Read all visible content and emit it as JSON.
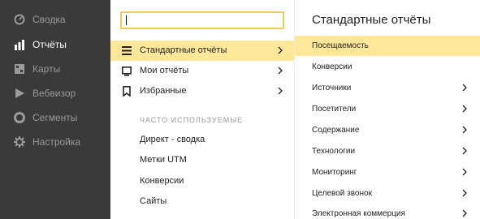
{
  "sidebar": {
    "items": [
      {
        "label": "Сводка",
        "icon": "dashboard-icon"
      },
      {
        "label": "Отчёты",
        "icon": "bar-chart-icon"
      },
      {
        "label": "Карты",
        "icon": "map-icon"
      },
      {
        "label": "Вебвизор",
        "icon": "play-icon"
      },
      {
        "label": "Сегменты",
        "icon": "segments-icon"
      },
      {
        "label": "Настройка",
        "icon": "gear-icon"
      }
    ],
    "active": "Отчёты"
  },
  "menu": {
    "search": {
      "value": ""
    },
    "items": [
      {
        "label": "Стандартные отчёты",
        "icon": "list-icon"
      },
      {
        "label": "Мои отчёты",
        "icon": "monitor-icon"
      },
      {
        "label": "Избранные",
        "icon": "bookmark-icon"
      }
    ],
    "section_title": "ЧАСТО ИСПОЛЬЗУЕМЫЕ",
    "frequent": [
      "Директ - сводка",
      "Метки UTM",
      "Конверсии",
      "Сайты"
    ]
  },
  "panel": {
    "title": "Стандартные отчёты",
    "items": [
      {
        "label": "Посещаемость"
      },
      {
        "label": "Конверсии"
      },
      {
        "label": "Источники"
      },
      {
        "label": "Посетители"
      },
      {
        "label": "Содержание"
      },
      {
        "label": "Технологии"
      },
      {
        "label": "Мониторинг"
      },
      {
        "label": "Целевой звонок"
      },
      {
        "label": "Электронная коммерция"
      }
    ]
  },
  "colors": {
    "sidebar_bg": "#3a3a3a",
    "highlight": "#fde89a",
    "search_border": "#f2cc55",
    "muted_text": "#9a9a9a"
  }
}
